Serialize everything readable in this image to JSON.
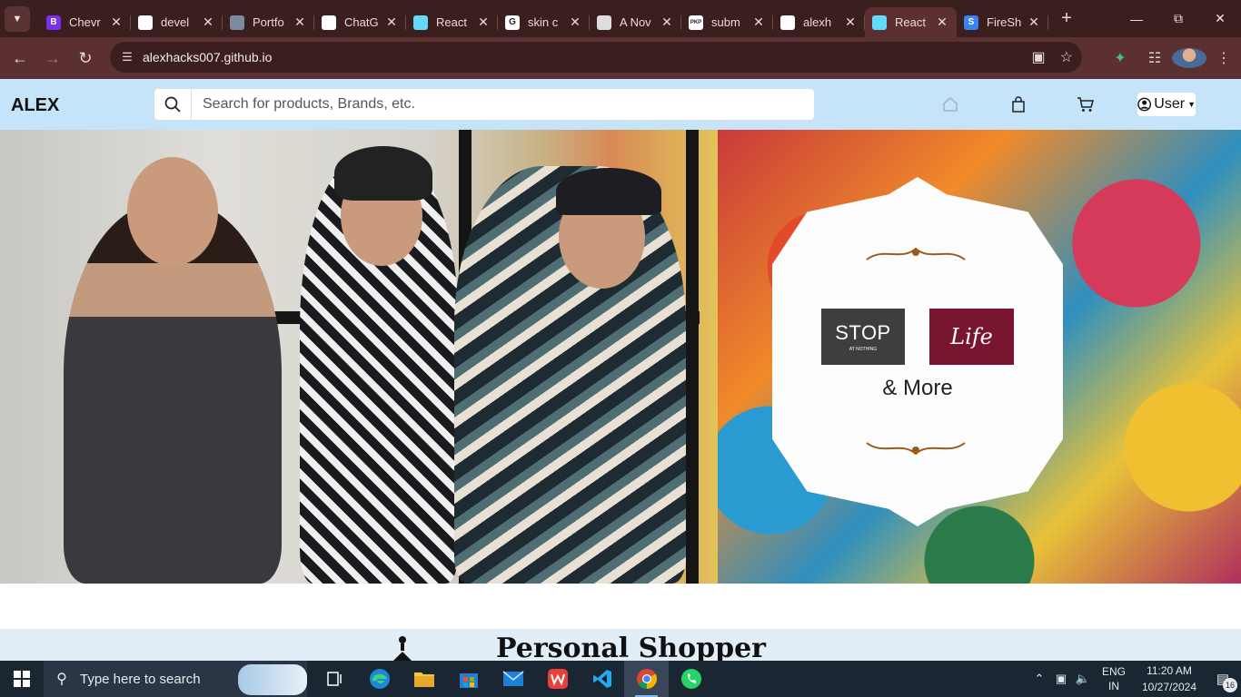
{
  "browser": {
    "tabs": [
      {
        "title": "Chevr",
        "favicon": "bootstrap-icon",
        "fav_color": "#7b2ff0",
        "fav_text": "B"
      },
      {
        "title": "devel",
        "favicon": "github-icon",
        "fav_color": "#ffffff",
        "fav_text": ""
      },
      {
        "title": "Portfo",
        "favicon": "avatar-icon",
        "fav_color": "#7a8aa0",
        "fav_text": ""
      },
      {
        "title": "ChatG",
        "favicon": "openai-icon",
        "fav_color": "#ffffff",
        "fav_text": ""
      },
      {
        "title": "React",
        "favicon": "react-icon",
        "fav_color": "#61dafb",
        "fav_text": ""
      },
      {
        "title": "skin c",
        "favicon": "google-icon",
        "fav_color": "#ffffff",
        "fav_text": "G"
      },
      {
        "title": "A Nov",
        "favicon": "medium-icon",
        "fav_color": "#dddddd",
        "fav_text": ""
      },
      {
        "title": "subm",
        "favicon": "pkp-icon",
        "fav_color": "#ffffff",
        "fav_text": "PKP"
      },
      {
        "title": "alexh",
        "favicon": "github-icon",
        "fav_color": "#ffffff",
        "fav_text": ""
      },
      {
        "title": "React",
        "favicon": "react-icon",
        "fav_color": "#61dafb",
        "fav_text": "",
        "active": true
      },
      {
        "title": "FireSh",
        "favicon": "fireship-icon",
        "fav_color": "#3b82f6",
        "fav_text": "S"
      }
    ],
    "url": "alexhacks007.github.io"
  },
  "site": {
    "brand": "ALEX",
    "search_placeholder": "Search for products, Brands, etc.",
    "user_label": "User"
  },
  "hero": {
    "logo_stop": "STOP",
    "logo_stop_tagline": "AT NOTHING",
    "logo_life": "Life",
    "more_text": "& More"
  },
  "section": {
    "title": "Personal Shopper"
  },
  "taskbar": {
    "search_placeholder": "Type here to search",
    "lang_line1": "ENG",
    "lang_line2": "IN",
    "time": "11:20 AM",
    "date": "10/27/2024",
    "notification_count": "16"
  },
  "colors": {
    "header_bg": "#c5e4f9",
    "browser_frame": "#3b1f1f",
    "toolbar": "#5c3030",
    "life_logo": "#7a1530"
  }
}
